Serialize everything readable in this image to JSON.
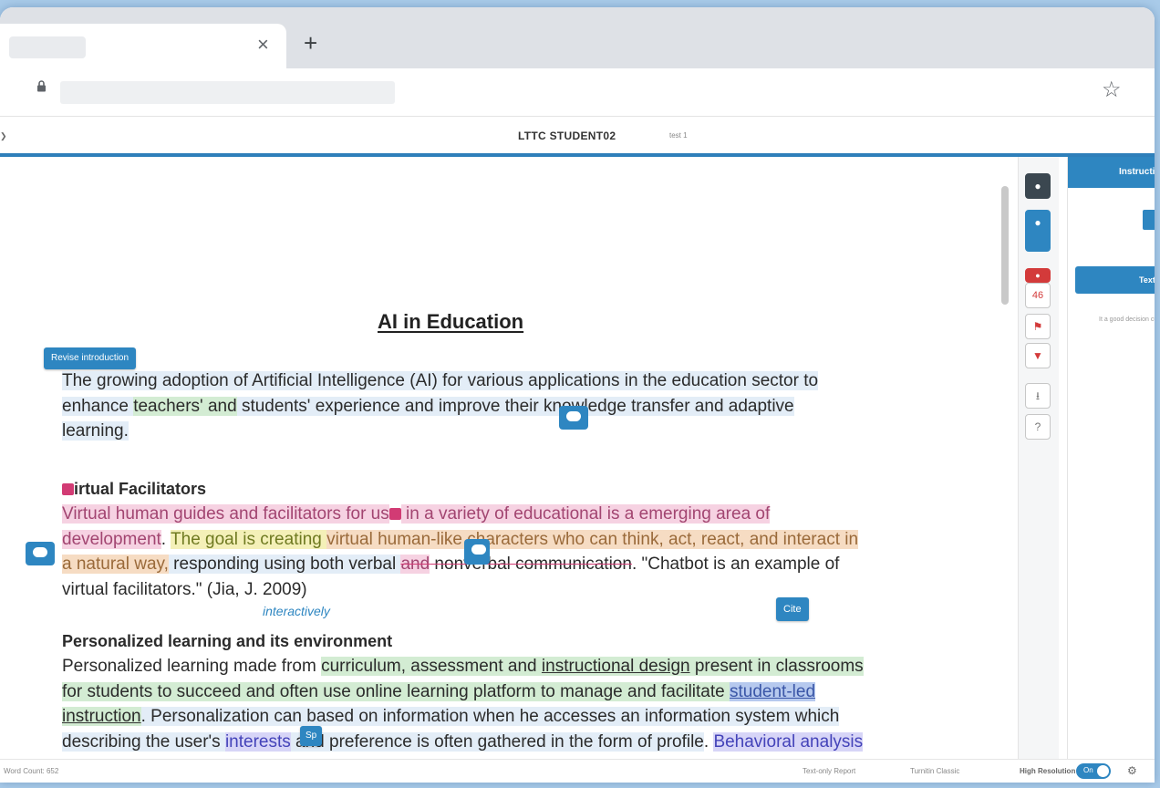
{
  "browser": {
    "tab_close_glyph": "×",
    "new_tab_glyph": "+",
    "lock_glyph": "🔒",
    "star_glyph": "☆"
  },
  "header": {
    "title": "LTTC STUDENT02",
    "subtitle": "test 1",
    "left_glyph": "❯"
  },
  "document": {
    "title": "AI in Education",
    "chips": {
      "revise_intro": "Revise introduction",
      "cite": "Cite",
      "sp": "Sp"
    },
    "inline_note": "interactively",
    "p1": {
      "s1": "The growing adoption of Artificial Intelligence (AI) for various applications in the education sector to enhance ",
      "s2": "teachers' ",
      "s3": "and",
      "s4": " students' ",
      "s5": "experience and improve their knowledge transfer and adaptive learning."
    },
    "h2": "irtual Facilitators",
    "p2": {
      "s1": "Virtual human guides and facilitators for us",
      "s2": " in a variety of educational is a",
      "s3": " emerging area of development",
      "s4": ". ",
      "s5": "The goal is creating ",
      "s6": "virtual human-like characters who can think, act, react, and interact in a natural way,",
      "s7": " responding using both verbal ",
      "s8": "and",
      "s9": " nonverbal communication",
      "s10": ". \"Chatbot is an example of virtual facilitators.\" (Jia, J. 2009)"
    },
    "h3": "Personalized learning and its environment",
    "p3": {
      "s1": "Personalized learning made from ",
      "s2": "curriculum, assessment and ",
      "s3": "instructional design",
      "s4": " present in classrooms for students to succeed and often use online learning platform ",
      "s5": "to",
      "s6": " manage and facilitate ",
      "s7": "student-led",
      "s8": " instruction",
      "s9": ". Personalization can based on information when he accesses an information system which describing the user's ",
      "s10": "interests",
      "s11": " and preference is often gathered in the form of profile",
      "s12": ". ",
      "s13": "Behavioral analysis"
    }
  },
  "toolstrip": {
    "count": "46"
  },
  "rightpanel": {
    "header": "Instructions",
    "tab": "Text",
    "text": "It a good decision current technology"
  },
  "footer": {
    "word_count": "Word Count: 652",
    "text_only_report": "Text-only Report",
    "turnitin_classic": "Turnitin Classic",
    "high_resolution": "High Resolution",
    "toggle_label": "On"
  },
  "colors": {
    "accent": "#2e86c1",
    "pink_mark": "#d23b74",
    "green_mark": "#6cae6c",
    "purple_mark": "#9b59d0"
  }
}
